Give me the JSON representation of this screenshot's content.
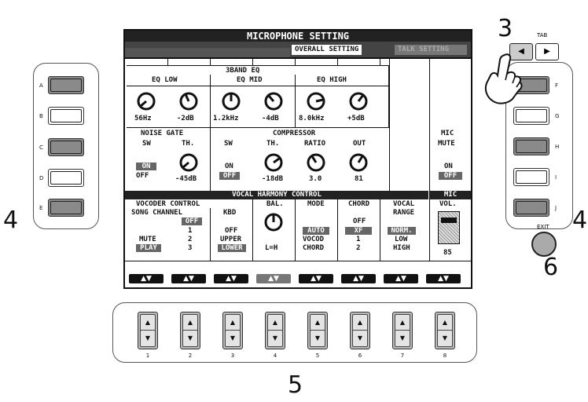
{
  "callouts": {
    "left_num": "4",
    "right_num": "4",
    "tab_num": "3",
    "exit_num": "6",
    "bottom_num": "5"
  },
  "left_panel": {
    "buttons": [
      {
        "label": "A",
        "style": "dark"
      },
      {
        "label": "B",
        "style": "light"
      },
      {
        "label": "C",
        "style": "dark"
      },
      {
        "label": "D",
        "style": "light"
      },
      {
        "label": "E",
        "style": "dark"
      }
    ]
  },
  "right_panel": {
    "tab_label": "TAB",
    "exit_label": "EXIT",
    "tab_left_icon": "◀",
    "tab_right_icon": "▶",
    "buttons": [
      {
        "label": "F",
        "style": "dark"
      },
      {
        "label": "G",
        "style": "light"
      },
      {
        "label": "H",
        "style": "dark"
      },
      {
        "label": "I",
        "style": "light"
      },
      {
        "label": "J",
        "style": "dark"
      }
    ]
  },
  "bottom_panel": {
    "up_icon": "▲",
    "down_icon": "▼",
    "numbers": [
      "1",
      "2",
      "3",
      "4",
      "5",
      "6",
      "7",
      "8"
    ]
  },
  "lcd": {
    "title": "MICROPHONE SETTING",
    "tabs": {
      "overall": "OVERALL SETTING",
      "talk": "TALK SETTING"
    },
    "eq": {
      "header": "3BAND EQ",
      "low_label": "EQ LOW",
      "mid_label": "EQ MID",
      "high_label": "EQ HIGH",
      "values": [
        "56Hz",
        "-2dB",
        "1.2kHz",
        "-4dB",
        "8.0kHz",
        "+5dB"
      ]
    },
    "noise_gate": {
      "header": "NOISE GATE",
      "sw": "SW",
      "th": "TH.",
      "on": "ON",
      "off": "OFF",
      "th_value": "-45dB"
    },
    "compressor": {
      "header": "COMPRESSOR",
      "sw": "SW",
      "th": "TH.",
      "ratio": "RATIO",
      "out": "OUT",
      "on": "ON",
      "off": "OFF",
      "th_value": "-18dB",
      "ratio_value": "3.0",
      "out_value": "81"
    },
    "mic_mute": {
      "header1": "MIC",
      "header2": "MUTE",
      "on": "ON",
      "off": "OFF"
    },
    "vocal_bar": "VOCAL HARMONY CONTROL",
    "mic_bar": "MIC",
    "vocoder": {
      "header1": "VOCODER CONTROL",
      "song_channel": "SONG CHANNEL",
      "kbd": "KBD",
      "song_opts": [
        "OFF",
        "1",
        "2",
        "3"
      ],
      "mute": "MUTE",
      "play": "PLAY",
      "kbd_opts": [
        "OFF",
        "UPPER",
        "LOWER"
      ]
    },
    "balance": {
      "header": "BAL.",
      "value": "L=H"
    },
    "mode": {
      "header": "MODE",
      "opts": [
        "AUTO",
        "VOCOD",
        "CHORD"
      ]
    },
    "chord": {
      "header": "CHORD",
      "opts": [
        "OFF",
        "XF",
        "1",
        "2"
      ]
    },
    "vocal_range": {
      "header1": "VOCAL",
      "header2": "RANGE",
      "opts": [
        "NORM.",
        "LOW",
        "HIGH"
      ]
    },
    "mic_vol": {
      "header": "VOL.",
      "value": "85"
    },
    "arrow": "▲▼"
  },
  "colors": {
    "lcd_dark": "#222222",
    "highlight": "#666666",
    "button_dark": "#8a8a8a"
  }
}
